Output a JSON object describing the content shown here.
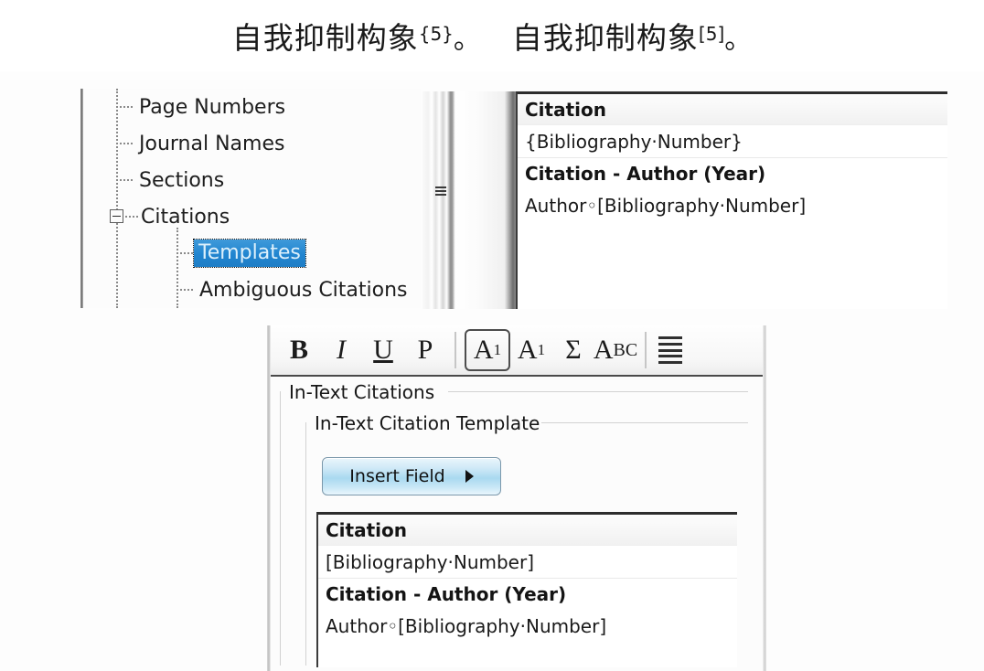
{
  "sample": {
    "left_text": "自我抑制构象",
    "left_citation": "{5}",
    "left_period": "。",
    "right_text": "自我抑制构象",
    "right_citation": "[5]",
    "right_period": "。"
  },
  "tree": {
    "items": [
      {
        "label": "Page Numbers",
        "level": 0,
        "expander": "none",
        "selected": false
      },
      {
        "label": "Journal Names",
        "level": 0,
        "expander": "none",
        "selected": false
      },
      {
        "label": "Sections",
        "level": 0,
        "expander": "none",
        "selected": false
      },
      {
        "label": "Citations",
        "level": 0,
        "expander": "minus",
        "selected": false
      },
      {
        "label": "Templates",
        "level": 1,
        "expander": "none",
        "selected": true
      },
      {
        "label": "Ambiguous Citations",
        "level": 1,
        "expander": "none",
        "selected": false
      }
    ],
    "selection_color": "#2185d0",
    "selected_text_color": "#ddf0fb"
  },
  "top_panel": {
    "grip_icon": "splitter-grip-icon",
    "templates": [
      {
        "name": "Citation",
        "value": "{Bibliography·Number}"
      },
      {
        "name": "Citation - Author (Year)",
        "value": "Author◦[Bibliography·Number]"
      }
    ]
  },
  "dialog": {
    "toolbar": {
      "buttons": [
        {
          "id": "bold",
          "label": "B",
          "icon": "bold-icon",
          "active": false
        },
        {
          "id": "italic",
          "label": "I",
          "icon": "italic-icon",
          "active": false
        },
        {
          "id": "underline",
          "label": "U",
          "icon": "underline-icon",
          "active": false
        },
        {
          "id": "plain",
          "label": "P",
          "icon": "plain-font-icon",
          "active": false
        },
        {
          "id": "superscript",
          "label": "A",
          "sup": "1",
          "icon": "superscript-icon",
          "active": true
        },
        {
          "id": "subscript",
          "label": "A",
          "sub": "1",
          "icon": "subscript-icon",
          "active": false
        },
        {
          "id": "symbol",
          "label": "Σ",
          "icon": "sigma-symbol-icon",
          "active": false
        },
        {
          "id": "smallcaps",
          "label": "A",
          "small": "BC",
          "icon": "small-caps-icon",
          "active": false
        },
        {
          "id": "lines",
          "label": "",
          "icon": "justify-lines-icon",
          "active": false
        }
      ]
    },
    "group_outer_title": "In-Text Citations",
    "group_inner_title": "In-Text Citation Template",
    "insert_field_label": "Insert Field",
    "insert_field_arrow": "▶",
    "templates": [
      {
        "name": "Citation",
        "value": "[Bibliography·Number]"
      },
      {
        "name": "Citation - Author (Year)",
        "value": "Author◦[Bibliography·Number]"
      }
    ]
  }
}
